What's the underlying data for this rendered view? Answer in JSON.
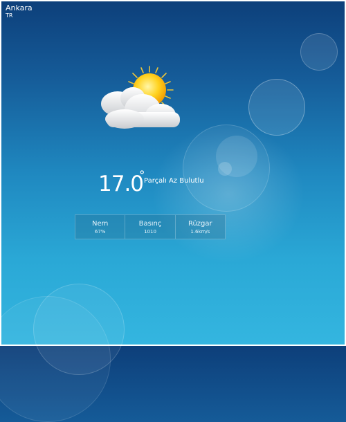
{
  "location": {
    "city": "Ankara",
    "country": "TR"
  },
  "current": {
    "temperature": "17.0",
    "degree_symbol": "°",
    "condition": "Parçalı Az Bulutlu",
    "icon": "partly-cloudy-icon"
  },
  "stats": [
    {
      "label": "Nem",
      "value": "67%"
    },
    {
      "label": "Basınç",
      "value": "1010"
    },
    {
      "label": "Rüzgar",
      "value": "1.6km/s"
    }
  ]
}
